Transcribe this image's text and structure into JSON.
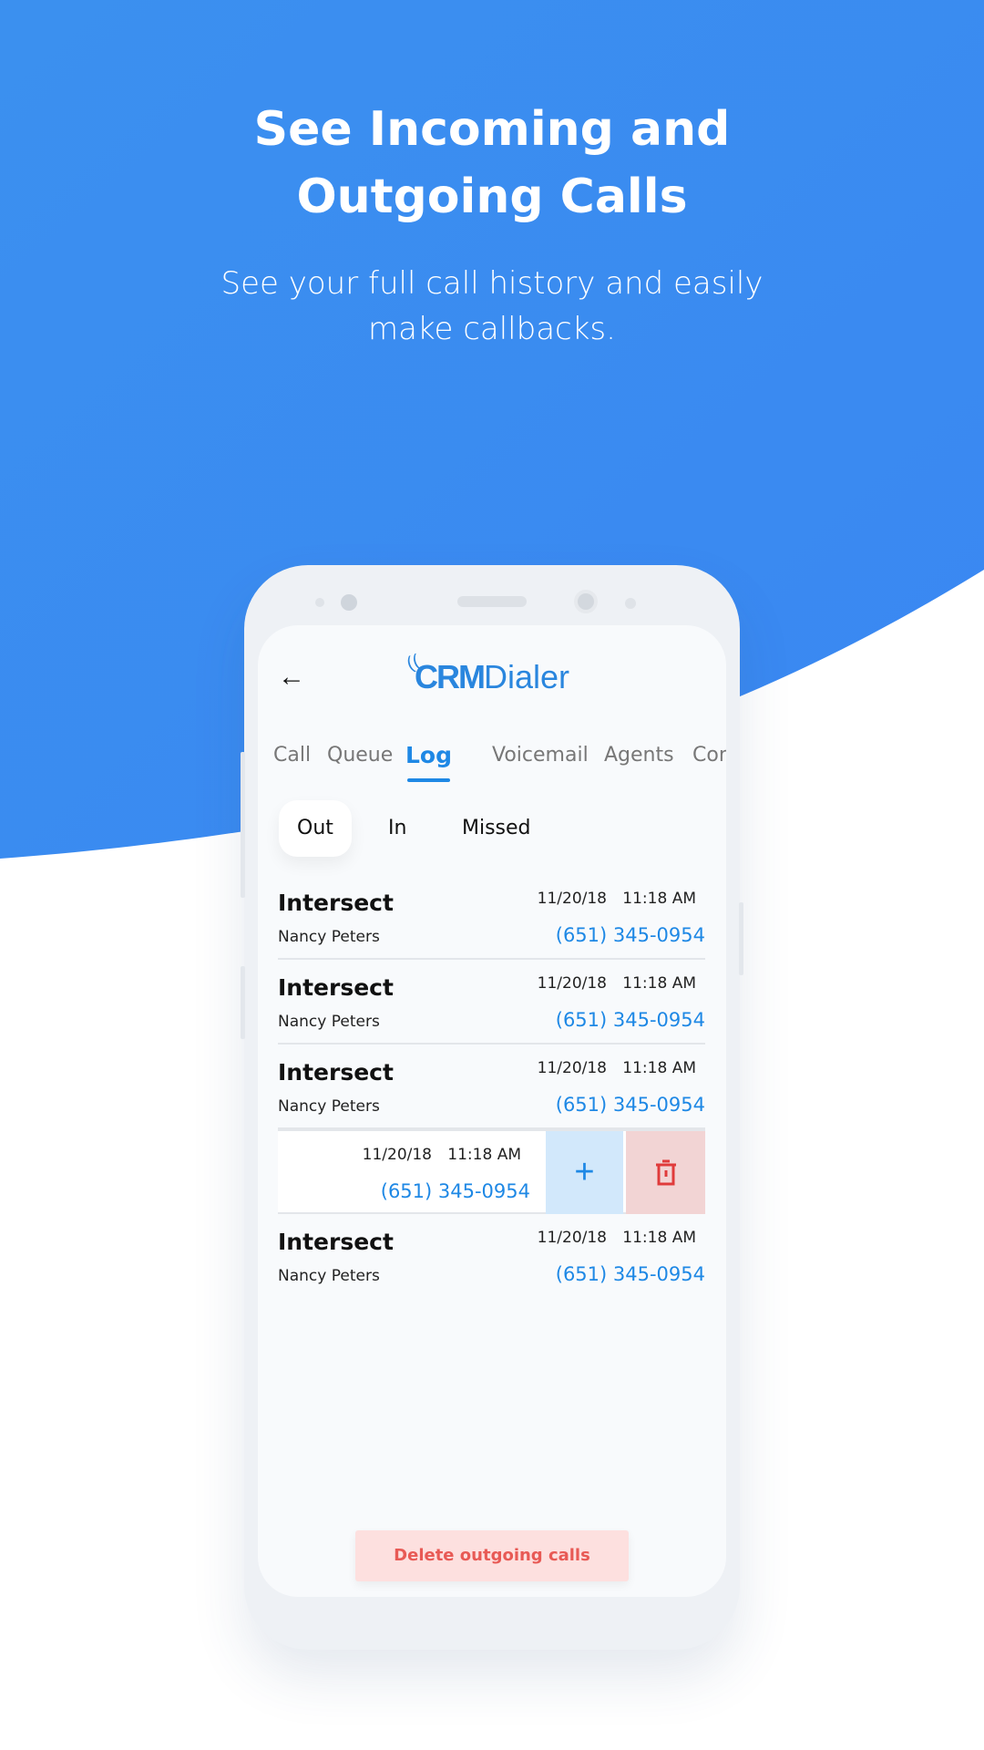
{
  "hero": {
    "title_line1": "See Incoming and",
    "title_line2": "Outgoing Calls",
    "subtitle_line1": "See your full call history and easily",
    "subtitle_line2": "make callbacks."
  },
  "colors": {
    "brand_blue": "#3a8ef0",
    "accent": "#1e88e5",
    "danger": "#e85a55"
  },
  "app": {
    "logo_bold": "CRM",
    "logo_light": "Dialer",
    "back_icon": "arrow-left-icon"
  },
  "tabs": [
    {
      "label": "Call"
    },
    {
      "label": "Queue"
    },
    {
      "label": "Log",
      "active": true
    },
    {
      "label": "Voicemail"
    },
    {
      "label": "Agents"
    },
    {
      "label": "Conta"
    }
  ],
  "subtabs": [
    {
      "label": "Out",
      "active": true
    },
    {
      "label": "In"
    },
    {
      "label": "Missed"
    }
  ],
  "calls": [
    {
      "title": "Intersect",
      "name": "Nancy Peters",
      "date": "11/20/18",
      "time": "11:18 AM",
      "phone": "(651) 345-0954"
    },
    {
      "title": "Intersect",
      "name": "Nancy Peters",
      "date": "11/20/18",
      "time": "11:18 AM",
      "phone": "(651) 345-0954"
    },
    {
      "title": "Intersect",
      "name": "Nancy Peters",
      "date": "11/20/18",
      "time": "11:18 AM",
      "phone": "(651) 345-0954"
    },
    {
      "date": "11/20/18",
      "time": "11:18 AM",
      "phone": "(651) 345-0954",
      "add_label": "+",
      "swiped": true
    },
    {
      "title": "Intersect",
      "name": "Nancy Peters",
      "date": "11/20/18",
      "time": "11:18 AM",
      "phone": "(651) 345-0954"
    }
  ],
  "delete_button": "Delete outgoing calls"
}
